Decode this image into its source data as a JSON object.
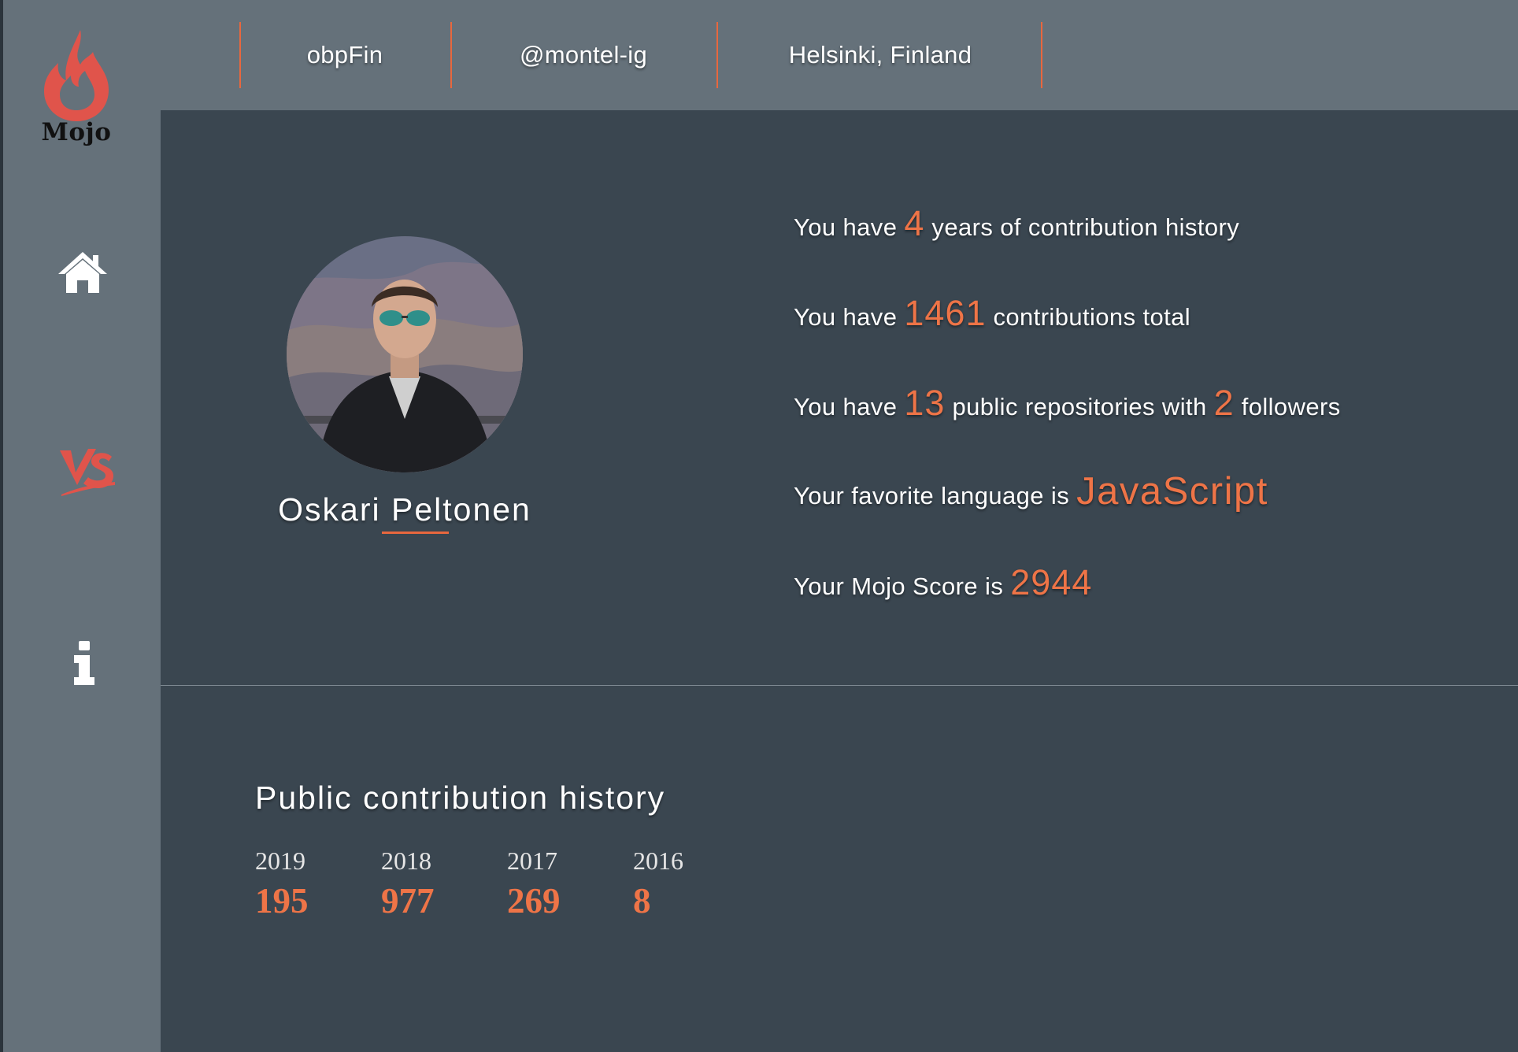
{
  "brand": {
    "name": "Mojo",
    "flame_color": "#e0544b"
  },
  "nav": {
    "items": [
      {
        "icon": "home-icon"
      },
      {
        "icon": "vs-icon",
        "color": "#e0544b"
      },
      {
        "icon": "info-icon"
      }
    ]
  },
  "topbar": {
    "items": [
      "obpFin",
      "@montel-ig",
      "Helsinki, Finland"
    ],
    "separator_color": "#e8673e"
  },
  "profile": {
    "name": "Oskari Peltonen"
  },
  "stats": {
    "years": {
      "prefix": "You have",
      "value": "4",
      "suffix": "years of contribution history"
    },
    "contributions": {
      "prefix": "You have",
      "value": "1461",
      "suffix": "contributions total"
    },
    "repos": {
      "prefix": "You have",
      "repos_value": "13",
      "middle": "public repositories with",
      "followers_value": "2",
      "suffix": "followers"
    },
    "language": {
      "prefix": "Your favorite language is",
      "value": "JavaScript"
    },
    "score": {
      "prefix": "Your Mojo Score is",
      "value": "2944"
    }
  },
  "history": {
    "title": "Public contribution history",
    "years": [
      {
        "year": "2019",
        "count": "195"
      },
      {
        "year": "2018",
        "count": "977"
      },
      {
        "year": "2017",
        "count": "269"
      },
      {
        "year": "2016",
        "count": "8"
      }
    ]
  },
  "colors": {
    "accent": "#ee7447",
    "sidebar": "#65717a",
    "background": "#3a4650"
  }
}
